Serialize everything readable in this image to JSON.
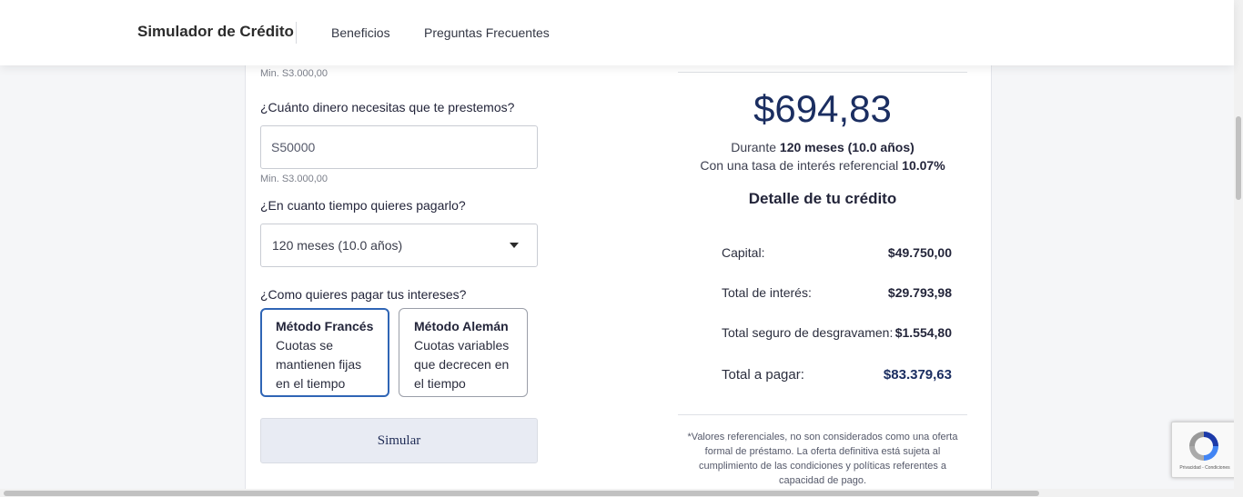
{
  "header": {
    "brand": "Simulador de Crédito",
    "nav": [
      "Beneficios",
      "Preguntas Frecuentes"
    ]
  },
  "form": {
    "prev_min_hint": "Min. S3.000,00",
    "amount_question": "¿Cuánto dinero necesitas que te prestemos?",
    "amount_value": "S50000",
    "amount_min_hint": "Min. S3.000,00",
    "term_question": "¿En cuanto tiempo quieres pagarlo?",
    "term_selected": "120 meses (10.0 años)",
    "interest_question": "¿Como quieres pagar tus intereses?",
    "methods": [
      {
        "title": "Método Francés",
        "desc": "Cuotas se mantienen fijas en el tiempo",
        "selected": true
      },
      {
        "title": "Método Alemán",
        "desc": "Cuotas variables que decrecen en el tiempo",
        "selected": false
      }
    ],
    "submit_label": "Simular"
  },
  "result": {
    "monthly_payment": "$694,83",
    "duration_prefix": "Durante",
    "duration_value": "120 meses (10.0 años)",
    "rate_prefix": "Con una tasa de interés referencial",
    "rate_value": "10.07%",
    "detail_title": "Detalle de tu crédito",
    "details": [
      {
        "label": "Capital:",
        "value": "$49.750,00"
      },
      {
        "label": "Total de interés:",
        "value": "$29.793,98"
      },
      {
        "label": "Total seguro de desgravamen:",
        "value": "$1.554,80"
      },
      {
        "label": "Total a pagar:",
        "value": "$83.379,63"
      }
    ],
    "disclaimer": "*Valores referenciales, no son considerados como una oferta formal de préstamo. La oferta definitiva está sujeta al cumplimiento de las condiciones y políticas referentes a capacidad de pago."
  },
  "recaptcha": {
    "text": "Privacidad - Condiciones"
  },
  "colors": {
    "accent": "#2f65b5",
    "navy": "#1b2e61"
  }
}
